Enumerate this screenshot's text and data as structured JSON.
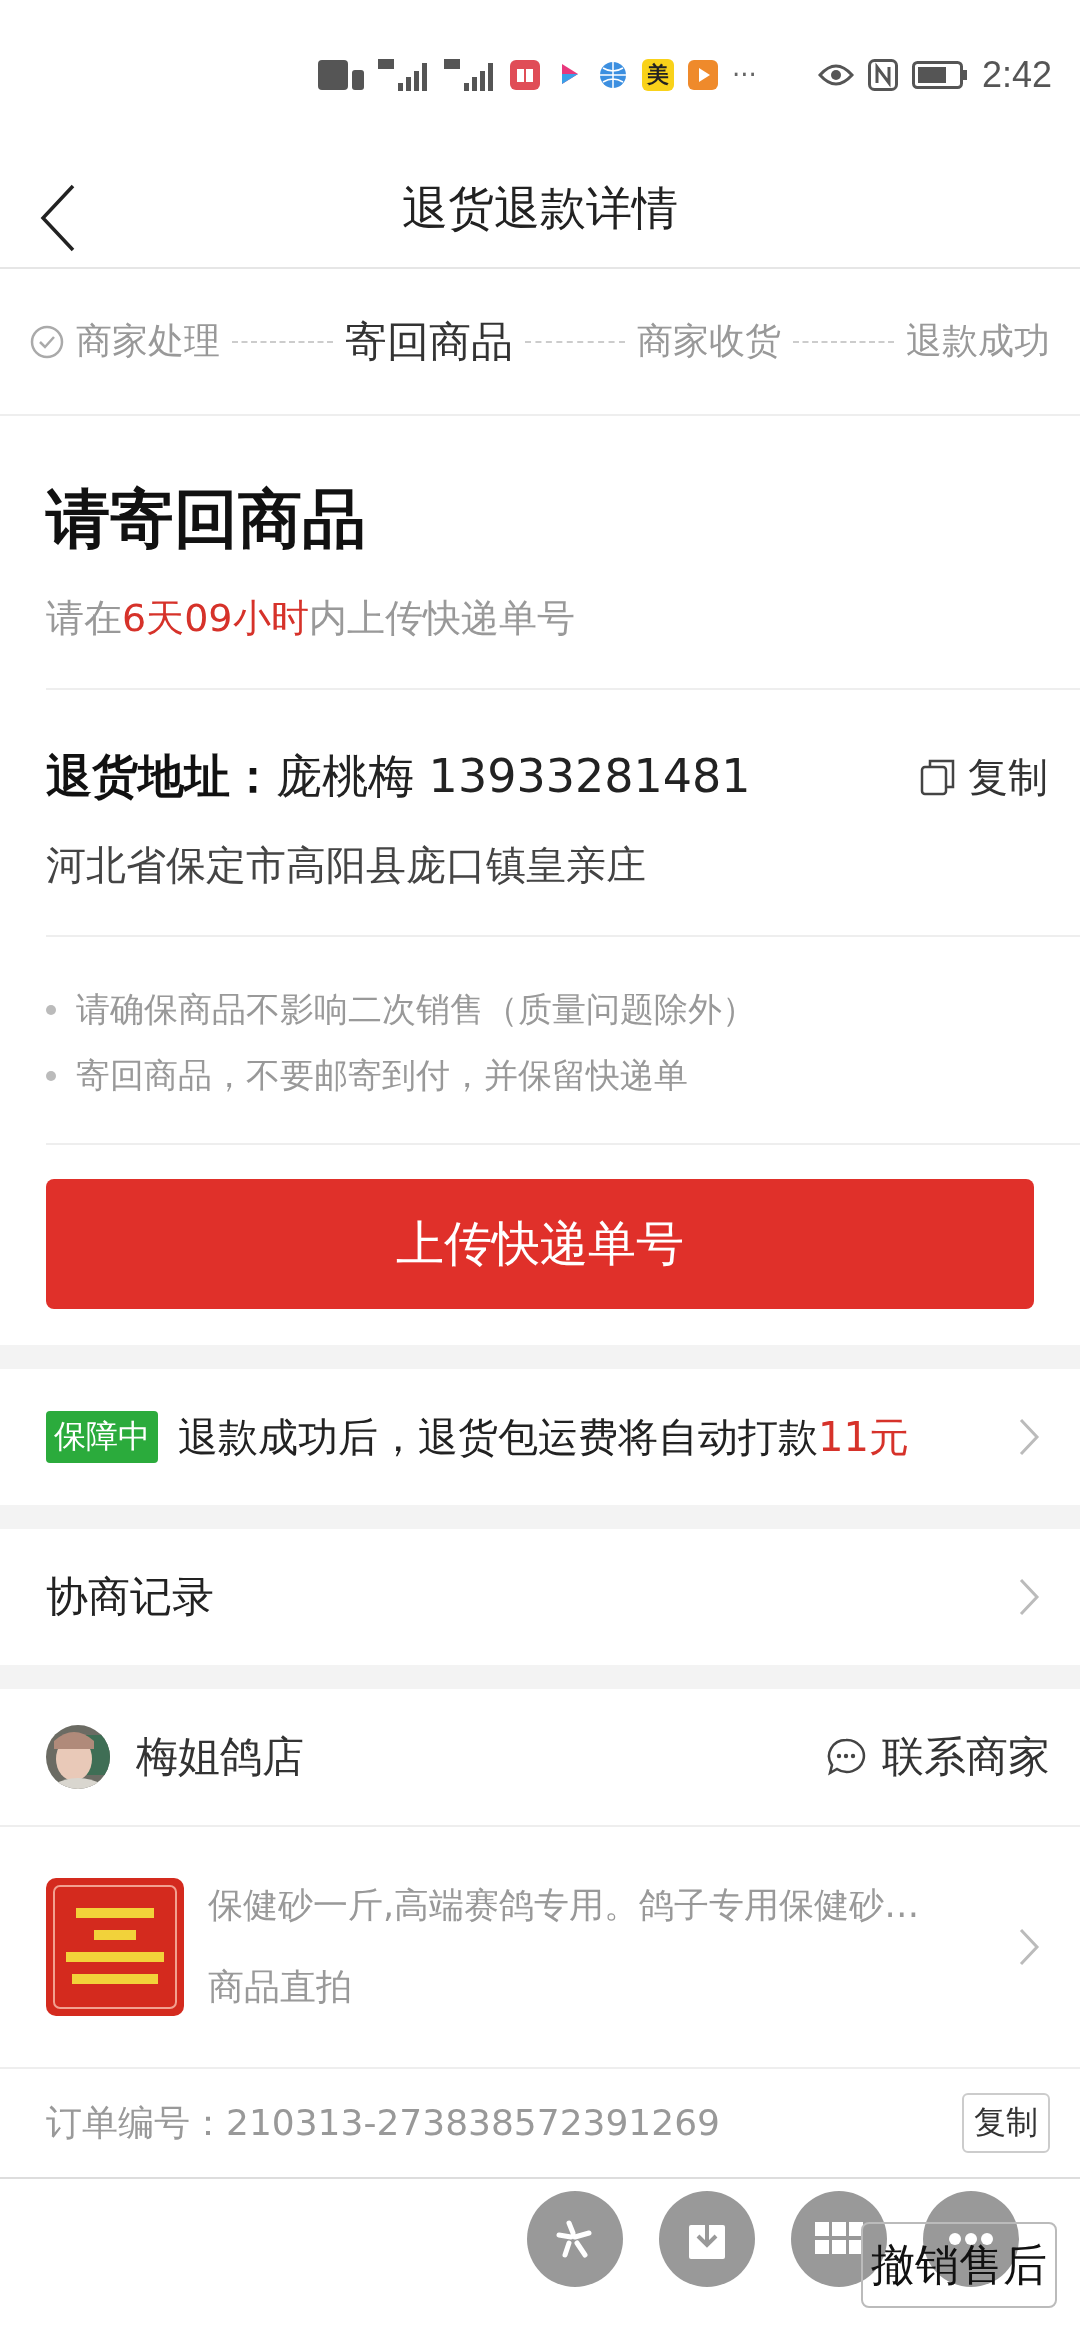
{
  "status_bar": {
    "time": "2:42",
    "more": "···",
    "app_icons": [
      {
        "kind": "book"
      },
      {
        "kind": "play"
      },
      {
        "kind": "globe"
      },
      {
        "kind": "mei",
        "label": "美"
      },
      {
        "kind": "video"
      }
    ]
  },
  "header": {
    "title": "退货退款详情"
  },
  "steps": [
    {
      "label": "商家处理",
      "done": true,
      "selected": false
    },
    {
      "label": "寄回商品",
      "done": false,
      "selected": true
    },
    {
      "label": "商家收货",
      "done": false,
      "selected": false
    },
    {
      "label": "退款成功",
      "done": false,
      "selected": false
    }
  ],
  "status": {
    "title": "请寄回商品",
    "subtitle": "请在**6天09小时**内上传快递单号"
  },
  "address": {
    "label": "退货地址：",
    "contact": "庞桃梅 13933281481",
    "copy": "复制",
    "detail": "河北省保定市高阳县庞口镇皇亲庄"
  },
  "notes": [
    "请确保商品不影响二次销售（质量问题除外）",
    "寄回商品，不要邮寄到付，并保留快递单"
  ],
  "upload_button": "上传快递单号",
  "guarantee": {
    "badge": "保障中",
    "text": "退款成功后，退货包运费将自动打款",
    "amount": "11元"
  },
  "negotiation": {
    "label": "协商记录"
  },
  "store": {
    "name": "梅姐鸽店",
    "contact": "联系商家"
  },
  "product": {
    "title": "保健砂一斤,高端赛鸽专用。鸽子专用保健砂…",
    "subtitle": "商品直拍"
  },
  "order": {
    "label": "订单编号：",
    "number": "210313-273838572391269",
    "copy": "复制"
  },
  "floating_buttons": [
    {
      "kind": "sparkle"
    },
    {
      "kind": "download"
    },
    {
      "kind": "grid"
    },
    {
      "kind": "dots"
    }
  ],
  "cancel_button": "撤销售后"
}
